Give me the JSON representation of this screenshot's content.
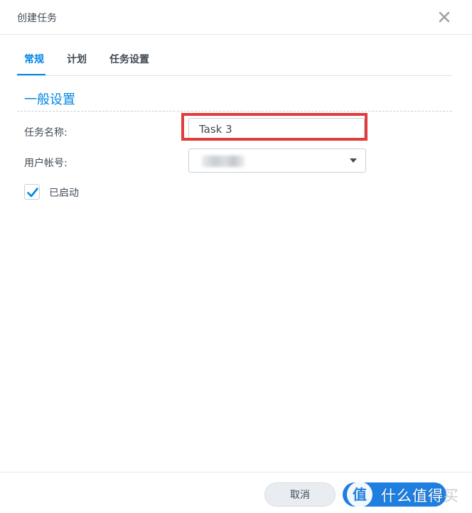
{
  "dialog": {
    "title": "创建任务"
  },
  "tabs": [
    {
      "label": "常规",
      "active": true
    },
    {
      "label": "计划",
      "active": false
    },
    {
      "label": "任务设置",
      "active": false
    }
  ],
  "general": {
    "section_title": "一般设置",
    "task_name_label": "任务名称:",
    "task_name_value": "Task 3",
    "user_label": "用户帐号:",
    "user_value": "",
    "enabled_label": "已启动",
    "enabled_checked": true
  },
  "footer": {
    "cancel_label": "取消",
    "ok_label": ""
  },
  "watermark": {
    "badge": "值",
    "text_main": "什么值得",
    "text_tail": "买"
  },
  "colors": {
    "accent": "#0086e5",
    "highlight": "#e23b3b",
    "primary_button": "#1f7fe0"
  },
  "icons": {
    "close": "close-icon",
    "dropdown": "caret-down-icon",
    "check": "checkmark-icon"
  }
}
